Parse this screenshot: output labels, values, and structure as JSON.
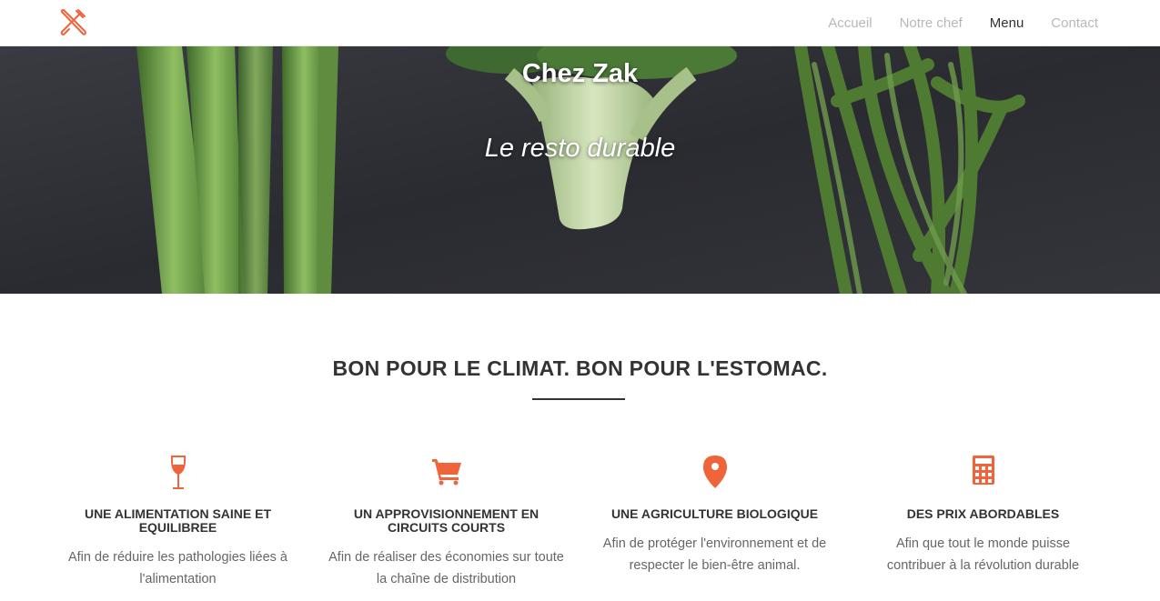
{
  "nav": {
    "logo_icon": "fork-knife-icon",
    "links": [
      {
        "label": "Accueil",
        "active": false
      },
      {
        "label": "Notre chef",
        "active": false
      },
      {
        "label": "Menu",
        "active": true
      },
      {
        "label": "Contact",
        "active": false
      }
    ]
  },
  "hero": {
    "title": "Chez Zak",
    "tagline": "Le resto durable"
  },
  "section": {
    "title": "BON POUR LE CLIMAT. BON POUR L'ESTOMAC."
  },
  "features": [
    {
      "icon": "wine-glass-icon",
      "heading": "UNE ALIMENTATION SAINE ET EQUILIBREE",
      "text": "Afin de réduire les pathologies liées à l'alimentation"
    },
    {
      "icon": "shopping-cart-icon",
      "heading": "UN APPROVISIONNEMENT EN CIRCUITS COURTS",
      "text": "Afin de réaliser des économies sur toute la chaîne de distribution"
    },
    {
      "icon": "map-pin-icon",
      "heading": "UNE AGRICULTURE BIOLOGIQUE",
      "text": "Afin de protéger l'environnement et de respecter le bien-être animal."
    },
    {
      "icon": "calculator-icon",
      "heading": "DES PRIX ABORDABLES",
      "text": "Afin que tout le monde puisse contribuer à la révolution durable"
    }
  ],
  "colors": {
    "accent": "#f0643c",
    "nav_inactive": "#b8b8b8",
    "nav_active": "#333333",
    "hero_bg": "#2c2d33"
  }
}
